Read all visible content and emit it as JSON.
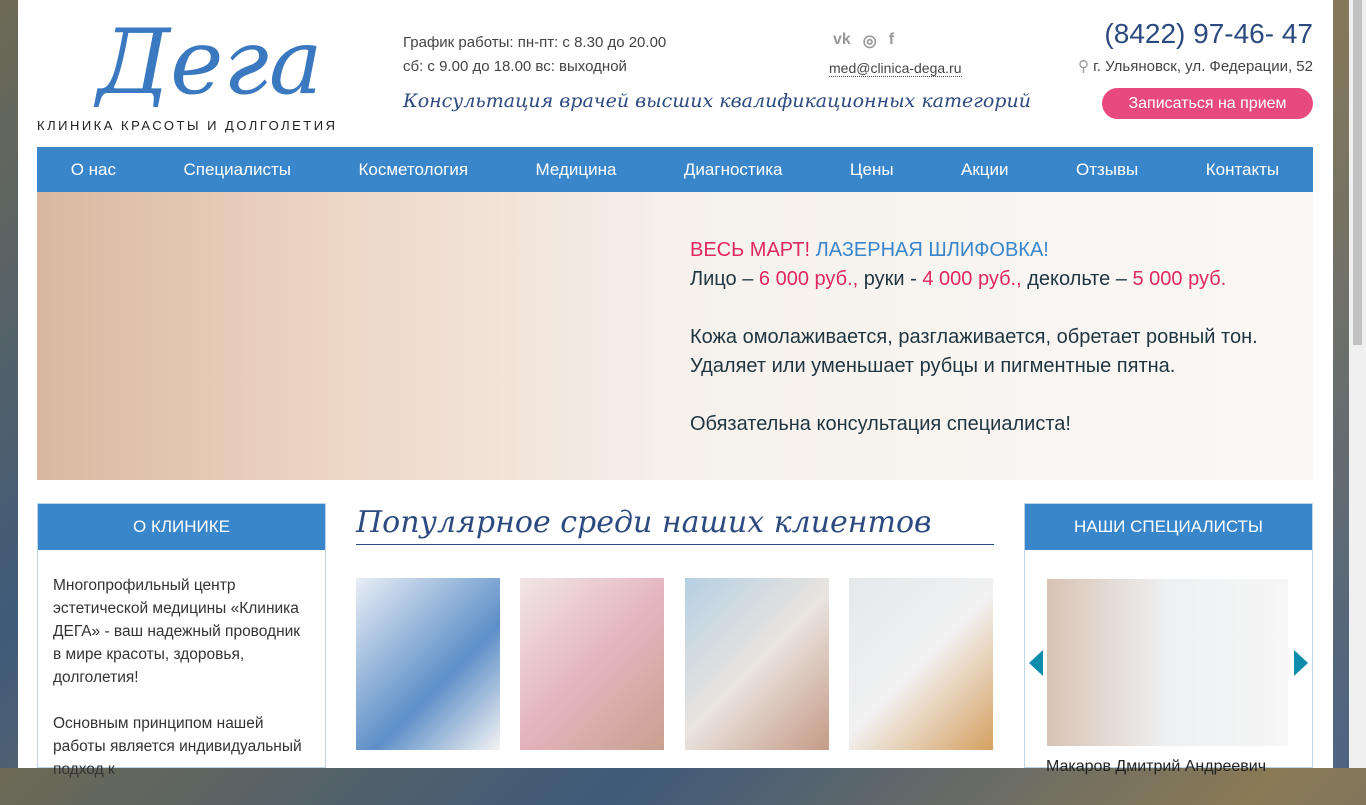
{
  "logo": {
    "script": "Дега",
    "subtitle": "КЛИНИКА КРАСОТЫ И ДОЛГОЛЕТИЯ"
  },
  "header": {
    "schedule_1": "График работы: пн-пт: с 8.30 до 20.00",
    "schedule_2": "сб: с 9.00 до 18.00 вс: выходной",
    "slogan": "Консультация врачей высших квалификационных категорий",
    "social": [
      "vk",
      "instagram",
      "facebook"
    ],
    "email": "med@clinica-dega.ru",
    "phone": "(8422) 97-46- 47",
    "address": "г. Ульяновск, ул. Федерации, 52",
    "book_label": "Записаться на прием"
  },
  "nav": [
    "О нас",
    "Специалисты",
    "Косметология",
    "Медицина",
    "Диагностика",
    "Цены",
    "Акции",
    "Отзывы",
    "Контакты"
  ],
  "hero": {
    "a": "ВЕСЬ МАРТ!",
    "b": "ЛАЗЕРНАЯ ШЛИФОВКА!",
    "l1": "Лицо – ",
    "p1": "6 000 руб.,",
    "l2": " руки - ",
    "p2": "4 000 руб.,",
    "l3": " декольте – ",
    "p3": "5 000 руб.",
    "t1": "Кожа омолаживается, разглаживается, обретает ровный тон.",
    "t2": "Удаляет или уменьшает рубцы и пигментные пятна.",
    "t3": "Обязательна консультация специалиста!"
  },
  "about": {
    "title": "О КЛИНИКЕ",
    "p1": "Многопрофильный центр эстетической медицины «Клиника ДЕГА» - ваш надежный проводник в мире красоты, здоровья, долголетия!",
    "p2": "Основным принципом нашей работы является индивидуальный подход к"
  },
  "popular": {
    "title": "Популярное среди наших клиентов"
  },
  "specialists": {
    "title": "НАШИ СПЕЦИАЛИСТЫ",
    "name": "Макаров Дмитрий Андреевич"
  }
}
